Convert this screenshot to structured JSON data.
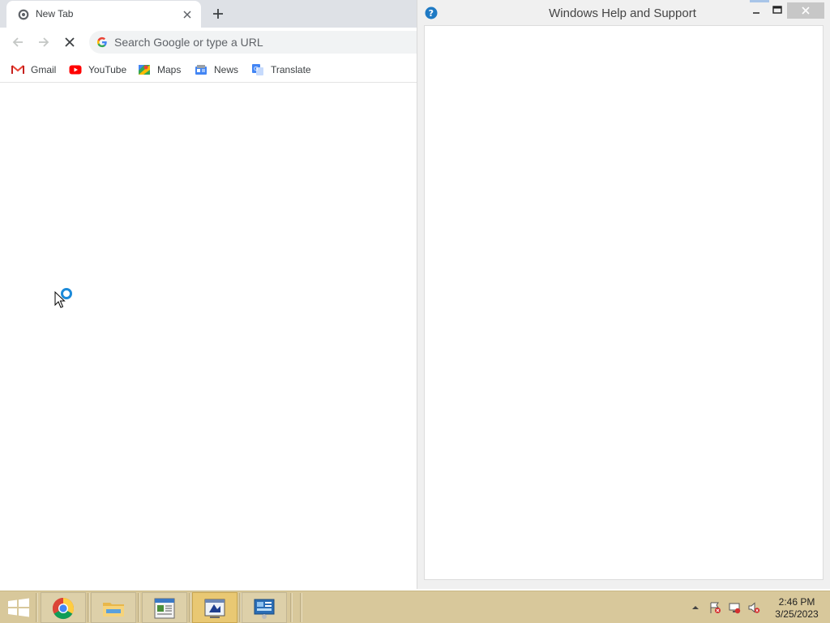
{
  "browser": {
    "tab": {
      "title": "New Tab",
      "close_icon": "close-icon",
      "favicon": "chrome-tab-icon"
    },
    "new_tab_icon": "plus-icon",
    "nav": {
      "back_icon": "back-arrow-icon",
      "forward_icon": "forward-arrow-icon",
      "reload_icon": "stop-loading-icon"
    },
    "omnibox": {
      "placeholder": "Search Google or type a URL",
      "value": ""
    },
    "bookmarks": [
      {
        "label": "Gmail",
        "icon": "gmail-icon"
      },
      {
        "label": "YouTube",
        "icon": "youtube-icon"
      },
      {
        "label": "Maps",
        "icon": "maps-icon"
      },
      {
        "label": "News",
        "icon": "news-icon"
      },
      {
        "label": "Translate",
        "icon": "translate-icon"
      }
    ]
  },
  "help_window": {
    "title": "Windows Help and Support",
    "controls": [
      "minimize-icon",
      "maximize-icon",
      "close-icon"
    ]
  },
  "taskbar": {
    "start_icon": "windows-start-icon",
    "apps": [
      {
        "name": "Google Chrome",
        "icon": "chrome-icon",
        "active": false
      },
      {
        "name": "File Explorer",
        "icon": "folder-icon",
        "active": false
      },
      {
        "name": "Notepad",
        "icon": "notepad-icon",
        "active": false
      },
      {
        "name": "Application",
        "icon": "app-window-icon",
        "active": true
      },
      {
        "name": "Control Panel",
        "icon": "control-panel-icon",
        "active": false
      }
    ],
    "tray": {
      "icons": [
        "show-hidden-icons-chevron",
        "action-center-flag-icon",
        "network-icon",
        "volume-muted-icon"
      ],
      "time": "2:46 PM",
      "date": "3/25/2023"
    }
  },
  "colors": {
    "taskbar": "#d8c89b",
    "active_app": "#e9c873",
    "tab_strip": "#dee1e6",
    "omnibox": "#f1f3f4"
  }
}
